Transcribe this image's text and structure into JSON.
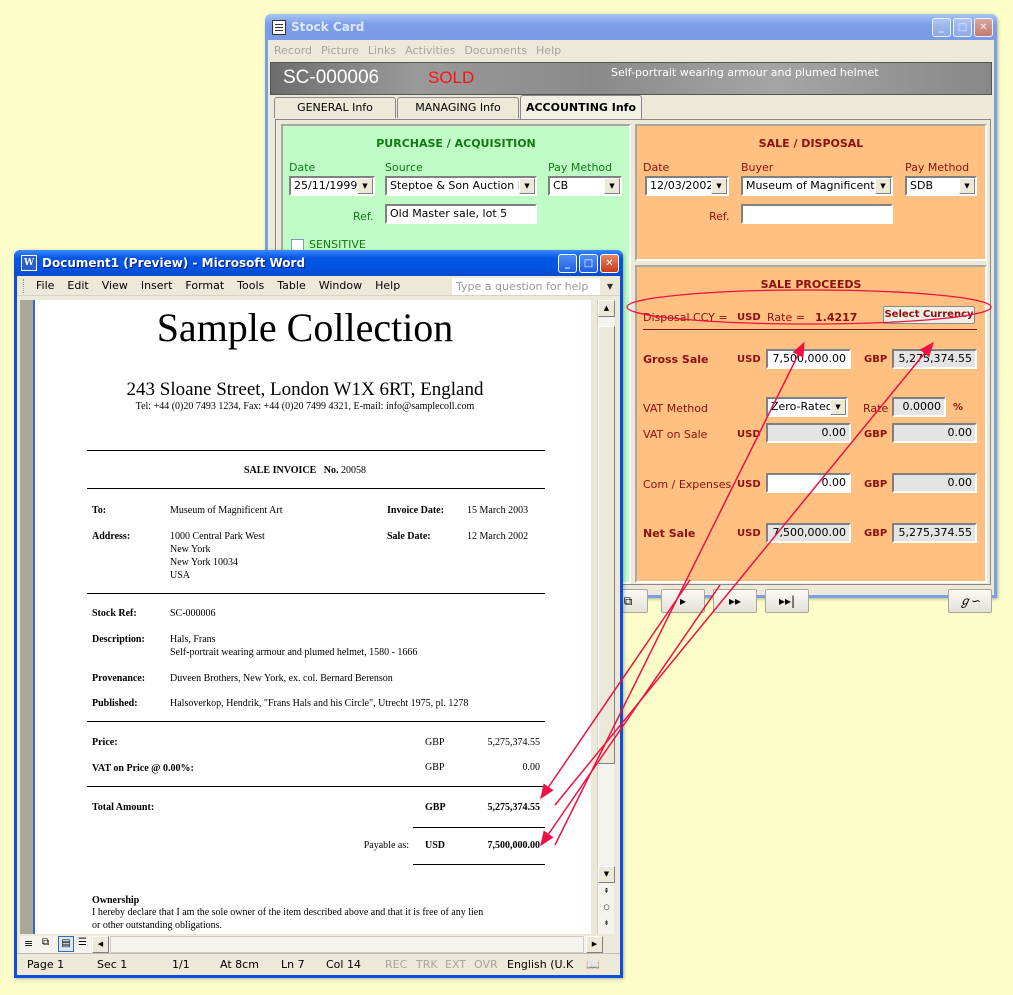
{
  "stock_card": {
    "window_title": "Stock Card",
    "menu": [
      "Record",
      "Picture",
      "Links",
      "Activities",
      "Documents",
      "Help"
    ],
    "stock_id": "SC-000006",
    "status": "SOLD",
    "item_title": "Self-portrait wearing armour and plumed helmet",
    "tabs": [
      {
        "label": "GENERAL Info",
        "active": false
      },
      {
        "label": "MANAGING Info",
        "active": false
      },
      {
        "label": "ACCOUNTING Info",
        "active": true
      }
    ],
    "purchase": {
      "heading": "PURCHASE / ACQUISITION",
      "date_label": "Date",
      "date_value": "25/11/1999",
      "source_label": "Source",
      "source_value": "Steptoe & Son Auction Hou",
      "pay_method_label": "Pay Method",
      "pay_method_value": "CB",
      "ref_label": "Ref.",
      "ref_value": "Old Master sale, lot 5",
      "sensitive_label": "SENSITIVE",
      "sensitive_checked": false
    },
    "sale": {
      "heading": "SALE / DISPOSAL",
      "date_label": "Date",
      "date_value": "12/03/2002",
      "buyer_label": "Buyer",
      "buyer_value": "Museum of Magnificent Art",
      "pay_method_label": "Pay Method",
      "pay_method_value": "SDB",
      "ref_label": "Ref.",
      "ref_value": ""
    },
    "proceeds": {
      "heading": "SALE PROCEEDS",
      "disposal_ccy_label": "Disposal CCY  =",
      "disposal_ccy": "USD",
      "rate_label": "Rate  =",
      "rate_value": "1.4217",
      "select_currency_button": "Select Currency",
      "gross_sale_label": "Gross Sale",
      "gross_sale_usd": "7,500,000.00",
      "gross_sale_gbp": "5,275,374.55",
      "vat_method_label": "VAT Method",
      "vat_method_value": "Zero-Rated",
      "vat_rate_label": "Rate",
      "vat_rate_value": "0.0000",
      "vat_rate_unit": "%",
      "vat_on_sale_label": "VAT on Sale",
      "vat_on_sale_usd": "0.00",
      "vat_on_sale_gbp": "0.00",
      "com_expenses_label": "Com / Expenses",
      "com_expenses_usd": "0.00",
      "com_expenses_gbp": "0.00",
      "net_sale_label": "Net Sale",
      "net_sale_usd": "7,500,000.00",
      "net_sale_gbp": "5,275,374.55",
      "usd": "USD",
      "gbp": "GBP"
    },
    "nav_icons": [
      "restore-window-icon",
      "next-record-icon",
      "fast-forward-icon",
      "last-record-icon",
      "signature-icon"
    ]
  },
  "word": {
    "window_title": "Document1 (Preview) - Microsoft Word",
    "menu": [
      "File",
      "Edit",
      "View",
      "Insert",
      "Format",
      "Tools",
      "Table",
      "Window",
      "Help"
    ],
    "help_placeholder": "Type a question for help",
    "status_bar": {
      "page": "Page  1",
      "sec": "Sec  1",
      "pages": "1/1",
      "at": "At  8cm",
      "ln": "Ln  7",
      "col": "Col  14",
      "rec": "REC",
      "trk": "TRK",
      "ext": "EXT",
      "ovr": "OVR",
      "language": "English (U.K"
    },
    "document": {
      "company": "Sample Collection",
      "address": "243 Sloane Street, London W1X 6RT, England",
      "contact": "Tel: +44 (0)20 7493 1234,   Fax: +44 (0)20 7499 4321,  E-mail: info@samplecoll.com",
      "invoice_heading": "SALE INVOICE",
      "invoice_no_label": "No.",
      "invoice_no": "20058",
      "to_label": "To:",
      "to_value": "Museum of Magnificent Art",
      "invoice_date_label": "Invoice Date:",
      "invoice_date": "15 March 2003",
      "address_label": "Address:",
      "address_lines": [
        "1000 Central Park West",
        "New York",
        "New York 10034",
        "USA"
      ],
      "sale_date_label": "Sale Date:",
      "sale_date": "12 March 2002",
      "stock_ref_label": "Stock Ref:",
      "stock_ref": "SC-000006",
      "description_label": "Description:",
      "description_lines": [
        "Hals, Frans",
        "Self-portrait wearing armour and plumed helmet, 1580 - 1666"
      ],
      "provenance_label": "Provenance:",
      "provenance": "Duveen Brothers, New York, ex. col. Bernard Berenson",
      "published_label": "Published:",
      "published": "Halsoverkop, Hendrik, \"Frans Hals and his Circle\", Utrecht 1975, pl. 1278",
      "price_label": "Price:",
      "price_ccy": "GBP",
      "price_value": "5,275,374.55",
      "vat_label": "VAT on Price @ 0.00%:",
      "vat_ccy": "GBP",
      "vat_value": "0.00",
      "total_label": "Total Amount:",
      "total_ccy": "GBP",
      "total_value": "5,275,374.55",
      "payable_label": "Payable as:",
      "payable_ccy": "USD",
      "payable_value": "7,500,000.00",
      "ownership_heading": "Ownership",
      "ownership_text_1": "I hereby declare that I am the sole owner of the item described above and that it is free of any lien",
      "ownership_text_2": "or other outstanding obligations."
    }
  },
  "annotation": {
    "color": "#ee1144"
  }
}
